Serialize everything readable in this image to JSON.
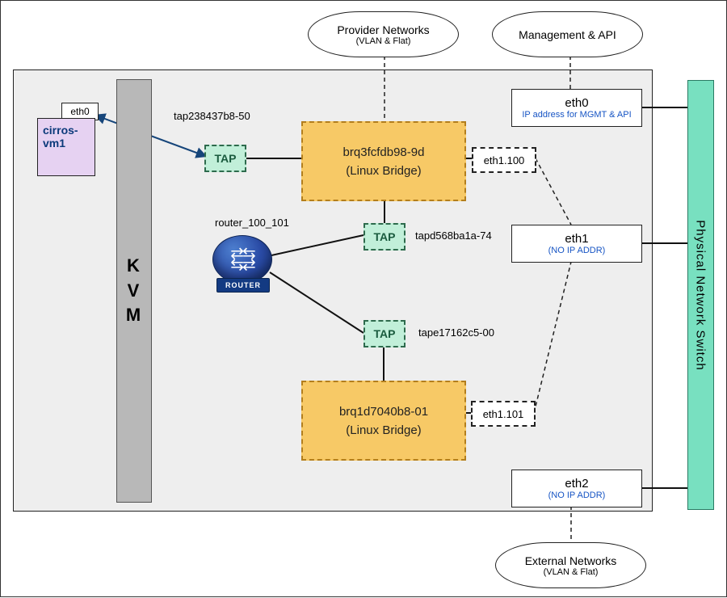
{
  "clouds": {
    "provider": {
      "title": "Provider Networks",
      "sub": "(VLAN & Flat)"
    },
    "mgmt": {
      "title": "Management & API",
      "sub": ""
    },
    "external": {
      "title": "External Networks",
      "sub": "(VLAN & Flat)"
    }
  },
  "vm": {
    "name": "cirros-vm1",
    "iface": "eth0"
  },
  "kvm": "K\nV\nM",
  "tap_label": "TAP",
  "taps": {
    "t1": "tap238437b8-50",
    "t2": "tapd568ba1a-74",
    "t3": "tape17162c5-00"
  },
  "bridges": {
    "b1": {
      "name": "brq3fcfdb98-9d",
      "sub": "(Linux Bridge)"
    },
    "b2": {
      "name": "brq1d7040b8-01",
      "sub": "(Linux Bridge)"
    }
  },
  "vlans": {
    "v1": "eth1.100",
    "v2": "eth1.101"
  },
  "nics": {
    "eth0": {
      "name": "eth0",
      "sub": "IP address for MGMT & API"
    },
    "eth1": {
      "name": "eth1",
      "sub": "(NO IP ADDR)"
    },
    "eth2": {
      "name": "eth2",
      "sub": "(NO IP ADDR)"
    }
  },
  "router": {
    "label": "router_100_101",
    "badge": "ROUTER"
  },
  "switch": "Physical Network Switch"
}
